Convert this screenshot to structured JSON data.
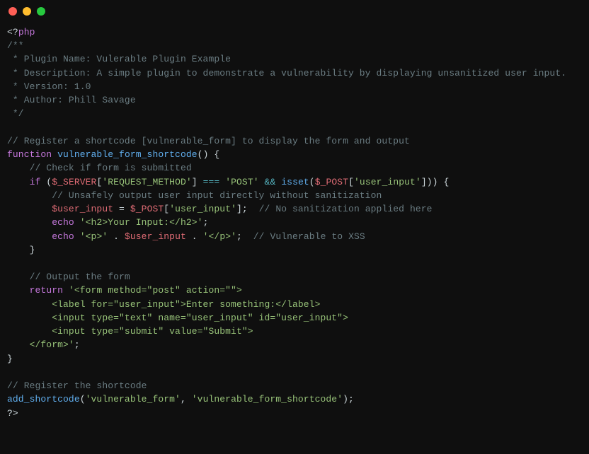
{
  "code": {
    "l01_open": "<?",
    "l01_php": "php",
    "l02": "/**",
    "l03": " * Plugin Name: Vulerable Plugin Example",
    "l04": " * Description: A simple plugin to demonstrate a vulnerability by displaying unsanitized user input.",
    "l05": " * Version: 1.0",
    "l06": " * Author: Phill Savage",
    "l07": " */",
    "l09": "// Register a shortcode [vulnerable_form] to display the form and output",
    "l10_kw": "function",
    "l10_name": "vulnerable_form_shortcode",
    "l10_rest": "() {",
    "l11": "    // Check if form is submitted",
    "l12_if": "    if",
    "l12_p1": " (",
    "l12_server": "$_SERVER",
    "l12_b1": "[",
    "l12_s1": "'REQUEST_METHOD'",
    "l12_b2": "] ",
    "l12_eqeqeq": "===",
    "l12_sp1": " ",
    "l12_post": "'POST'",
    "l12_sp2": " ",
    "l12_and": "&&",
    "l12_sp3": " ",
    "l12_isset": "isset",
    "l12_p2": "(",
    "l12_postvar": "$_POST",
    "l12_b3": "[",
    "l12_s2": "'user_input'",
    "l12_b4": "])) {",
    "l13": "        // Unsafely output user input directly without sanitization",
    "l14_pad": "        ",
    "l14_var": "$user_input",
    "l14_eq": " = ",
    "l14_post": "$_POST",
    "l14_b1": "[",
    "l14_s1": "'user_input'",
    "l14_b2": "];  ",
    "l14_c": "// No sanitization applied here",
    "l15_pad": "        ",
    "l15_echo": "echo",
    "l15_sp": " ",
    "l15_s": "'<h2>Your Input:</h2>'",
    "l15_end": ";",
    "l16_pad": "        ",
    "l16_echo": "echo",
    "l16_sp": " ",
    "l16_s1": "'<p>'",
    "l16_dot1": " . ",
    "l16_var": "$user_input",
    "l16_dot2": " . ",
    "l16_s2": "'</p>'",
    "l16_end": ";  ",
    "l16_c": "// Vulnerable to XSS",
    "l17": "    }",
    "l19": "    // Output the form",
    "l20_pad": "    ",
    "l20_return": "return",
    "l20_sp": " ",
    "l20_s": "'<form method=\"post\" action=\"\">",
    "l21": "        <label for=\"user_input\">Enter something:</label>",
    "l22": "        <input type=\"text\" name=\"user_input\" id=\"user_input\">",
    "l23": "        <input type=\"submit\" value=\"Submit\">",
    "l24": "    </form>'",
    "l24_end": ";",
    "l25": "}",
    "l27": "// Register the shortcode",
    "l28_fn": "add_shortcode",
    "l28_p1": "(",
    "l28_s1": "'vulnerable_form'",
    "l28_comma": ", ",
    "l28_s2": "'vulnerable_form_shortcode'",
    "l28_p2": ");",
    "l29": "?>"
  }
}
